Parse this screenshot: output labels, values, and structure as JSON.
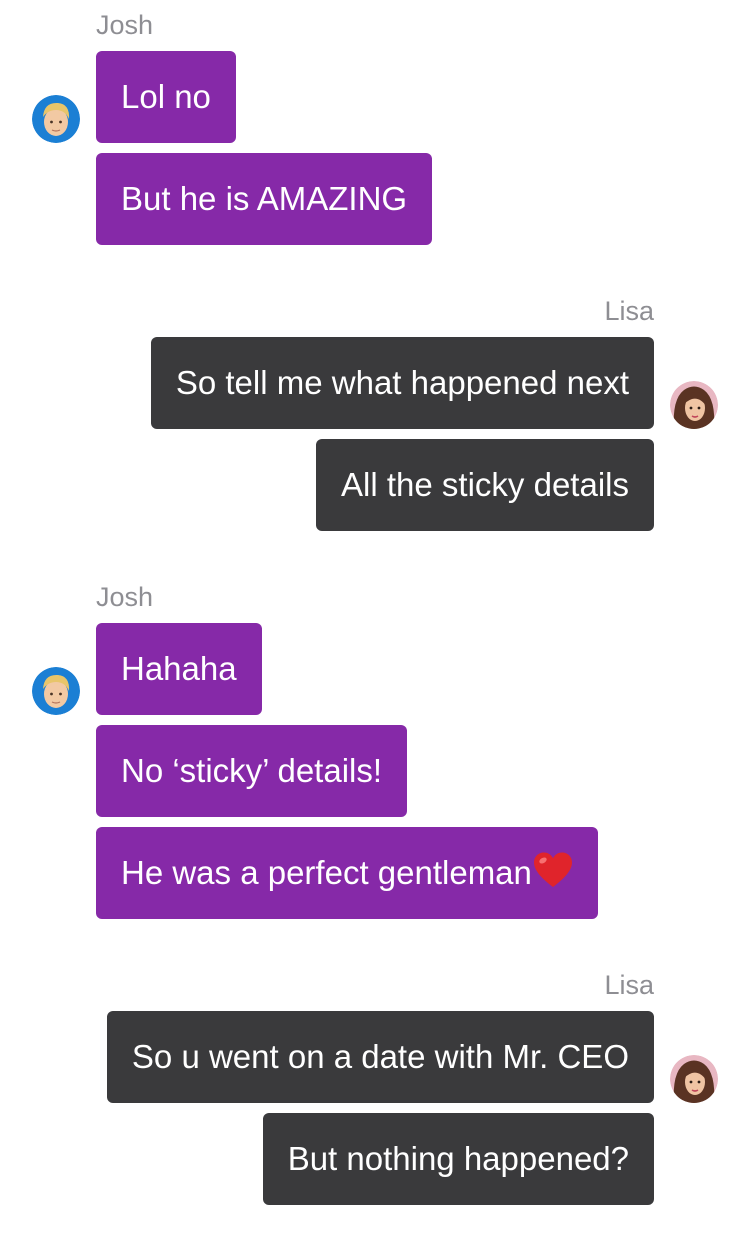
{
  "chat": {
    "groups": [
      {
        "sender": "Josh",
        "side": "incoming",
        "avatar": "josh-avatar",
        "messages": [
          "Lol no",
          "But he is AMAZING"
        ]
      },
      {
        "sender": "Lisa",
        "side": "outgoing",
        "avatar": "lisa-avatar",
        "messages": [
          "So tell me what happened next",
          "All the sticky details"
        ]
      },
      {
        "sender": "Josh",
        "side": "incoming",
        "avatar": "josh-avatar",
        "messages": [
          "Hahaha",
          "No ‘sticky’ details!",
          "He was a perfect gentleman"
        ]
      },
      {
        "sender": "Lisa",
        "side": "outgoing",
        "avatar": "lisa-avatar",
        "messages": [
          "So u went on a date with Mr. CEO",
          "But nothing happened?"
        ]
      }
    ]
  },
  "colors": {
    "incoming_bubble": "#8629a8",
    "outgoing_bubble": "#3a3a3c",
    "name_text": "#8e8e93",
    "heart": "#e0242b"
  },
  "icons": {
    "heart": "heart-emoji-icon"
  }
}
